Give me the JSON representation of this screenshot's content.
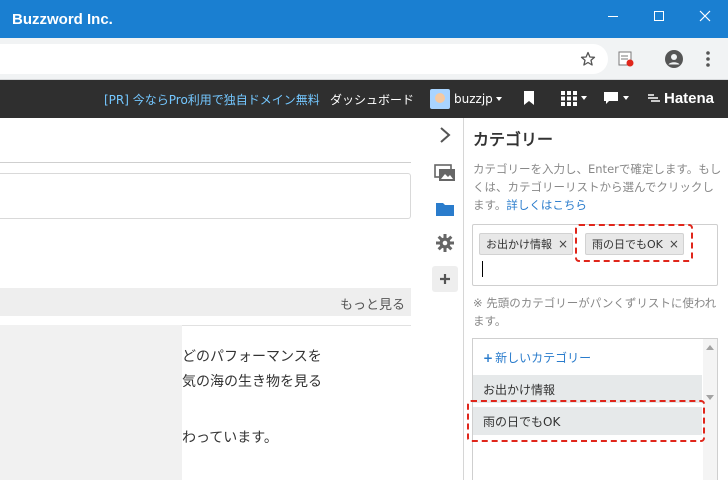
{
  "window": {
    "title": "Buzzword Inc."
  },
  "header": {
    "promo": "[PR] 今ならPro利用で独自ドメイン無料",
    "dashboard": "ダッシュボード",
    "user": "buzzjp",
    "logo": "Hatena"
  },
  "main": {
    "more_link": "もっと見る",
    "card_lines": [
      "どのパフォーマンスを",
      "気の海の生き物を見る",
      "わっています。"
    ]
  },
  "panel": {
    "title": "カテゴリー",
    "description": "カテゴリーを入力し、Enterで確定します。もしくは、カテゴリーリストから選んでクリックします。",
    "details_link": "詳しくはこちら",
    "tags": [
      "お出かけ情報",
      "雨の日でもOK"
    ],
    "tag_remove": "×",
    "note": "※ 先頭のカテゴリーがパンくずリストに使われます。",
    "new_category": "新しいカテゴリー",
    "categories": [
      "お出かけ情報",
      "雨の日でもOK"
    ]
  },
  "colors": {
    "titlebar": "#1a7fd1",
    "header": "#2f2f2f",
    "promo": "#74c7ff",
    "link": "#2a7ccc",
    "highlight": "#e0261b"
  },
  "icons": [
    "star-icon",
    "extension-icon",
    "account-icon",
    "menu-icon",
    "bookmark-icon",
    "grid-icon",
    "notification-icon",
    "chevron-right-icon",
    "image-icon",
    "folder-icon",
    "gear-icon",
    "plus-icon"
  ]
}
